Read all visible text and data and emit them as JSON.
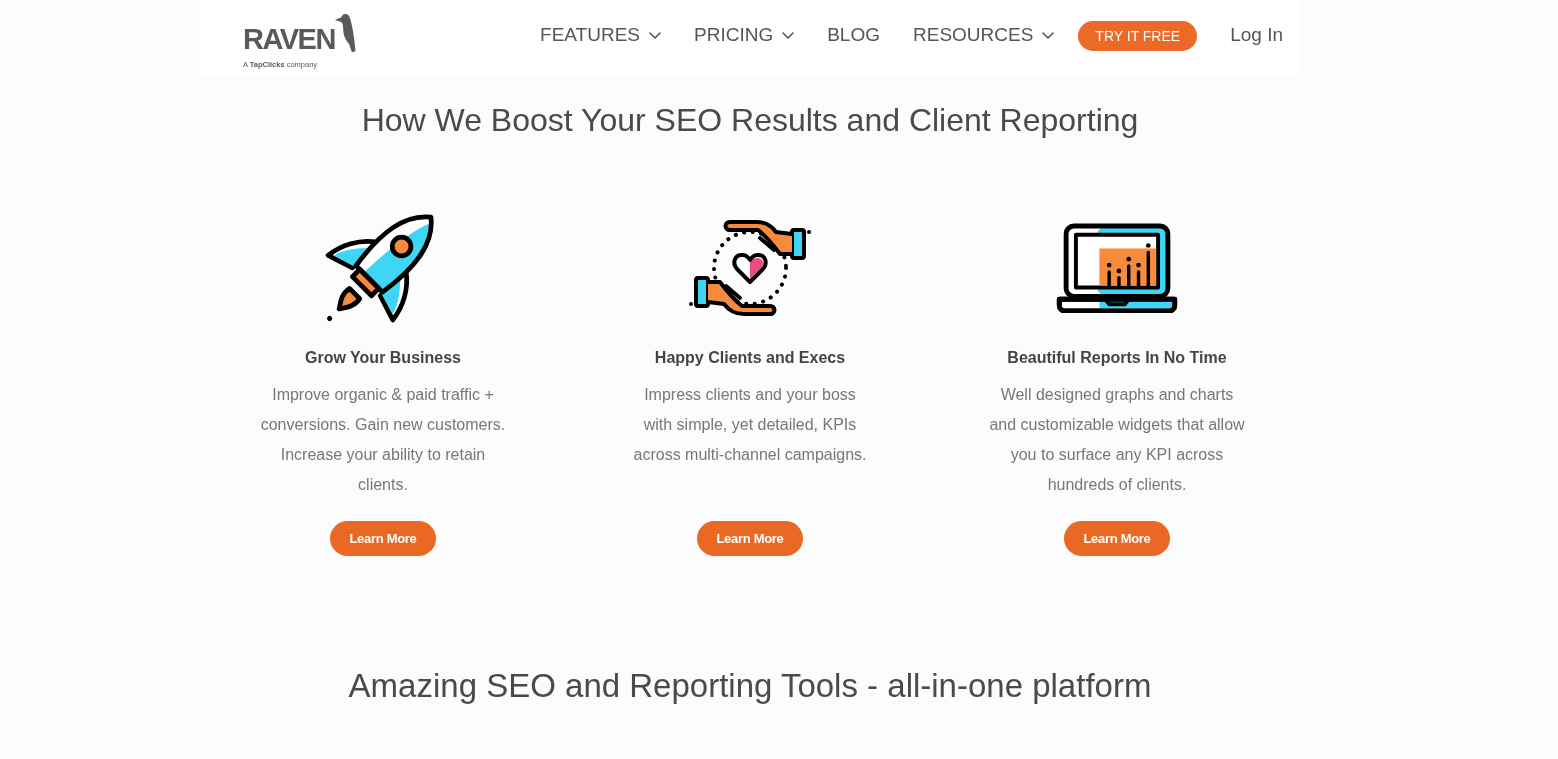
{
  "header": {
    "logo": {
      "wordmark": "RAVEN",
      "tagline": "A **TapClicks** company"
    },
    "nav": [
      {
        "label": "FEATURES",
        "dropdown": true
      },
      {
        "label": "PRICING",
        "dropdown": true
      },
      {
        "label": "BLOG",
        "dropdown": false
      },
      {
        "label": "RESOURCES",
        "dropdown": true
      }
    ],
    "cta_button": "TRY IT FREE",
    "login_link": "Log In"
  },
  "features_section": {
    "heading": "How We Boost Your SEO Results and Client Reporting",
    "features": [
      {
        "kind": "rocket",
        "title": "Grow Your Business",
        "description_lines": [
          "Improve organic & paid traffic +",
          "conversions. Gain new customers.",
          "Increase your ability to retain",
          "clients."
        ],
        "button": "Learn More"
      },
      {
        "kind": "hands",
        "title": "Happy Clients and Execs",
        "description_lines": [
          "Impress clients and your boss",
          "with simple, yet detailed, KPIs",
          "across multi-channel campaigns."
        ],
        "button": "Learn More"
      },
      {
        "kind": "laptop",
        "title": "Beautiful Reports In No Time",
        "description_lines": [
          "Well designed graphs and charts",
          "and customizable widgets that allow",
          "you to surface any KPI across",
          "hundreds of clients."
        ],
        "button": "Learn More"
      }
    ]
  },
  "tools_section": {
    "heading": "Amazing SEO and Reporting Tools - all-in-one platform"
  }
}
